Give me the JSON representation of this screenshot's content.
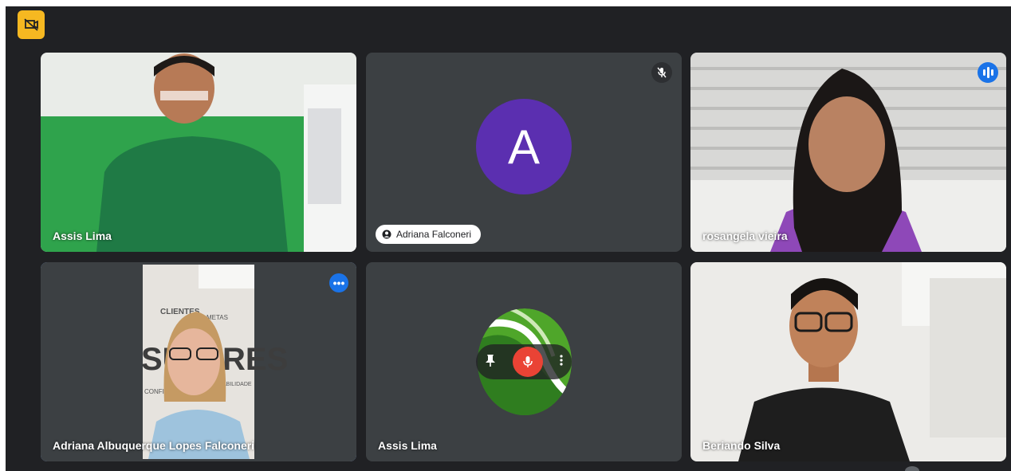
{
  "meeting": {
    "accent_color": "#1a73e8",
    "active_border_color": "#8ab4f8",
    "badge_icon": "no-recording-icon"
  },
  "tiles": [
    {
      "name": "Assis Lima",
      "kind": "video"
    },
    {
      "name": "Adriana Falconeri",
      "kind": "avatar",
      "avatar_letter": "A",
      "muted": true
    },
    {
      "name": "rosangela vieira",
      "kind": "video",
      "speaking": true
    },
    {
      "name": "Adriana Albuquerque Lopes Falconeri",
      "kind": "video",
      "active": true
    },
    {
      "name": "Assis Lima",
      "kind": "logo",
      "hover_controls": [
        "pin-icon",
        "mic-icon",
        "more-vert-icon"
      ]
    },
    {
      "name": "Beriando Silva",
      "kind": "video"
    }
  ],
  "more_options_glyph": "•••"
}
